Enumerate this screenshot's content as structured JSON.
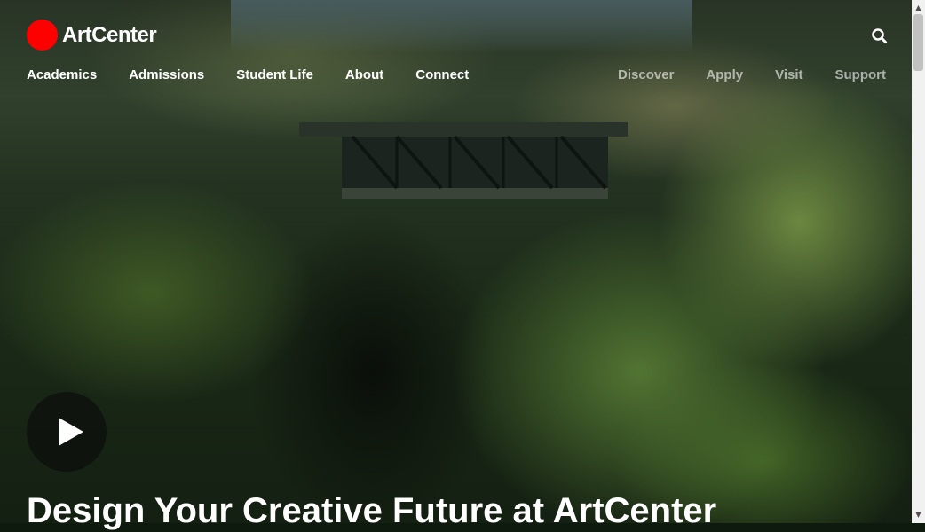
{
  "brand": {
    "name": "ArtCenter",
    "accent": "#ff0000"
  },
  "nav_primary": [
    {
      "label": "Academics"
    },
    {
      "label": "Admissions"
    },
    {
      "label": "Student Life"
    },
    {
      "label": "About"
    },
    {
      "label": "Connect"
    }
  ],
  "nav_secondary": [
    {
      "label": "Discover"
    },
    {
      "label": "Apply"
    },
    {
      "label": "Visit"
    },
    {
      "label": "Support"
    }
  ],
  "icons": {
    "search": "search-icon",
    "play": "play-icon"
  },
  "hero": {
    "headline": "Design Your Creative Future at ArtCenter"
  }
}
